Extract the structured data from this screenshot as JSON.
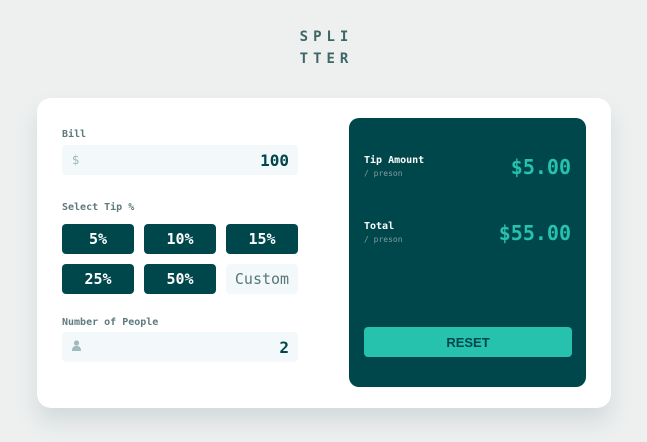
{
  "logo": {
    "line1": "SPLI",
    "line2": "TTER"
  },
  "bill": {
    "label": "Bill",
    "currency_symbol": "$",
    "value": "100"
  },
  "tip": {
    "label": "Select Tip %",
    "options": [
      "5%",
      "10%",
      "15%",
      "25%",
      "50%"
    ],
    "custom_placeholder": "Custom"
  },
  "people": {
    "label": "Number of People",
    "value": "2"
  },
  "results": {
    "tip_amount": {
      "title": "Tip Amount",
      "sub": "/ preson",
      "value": "$5.00"
    },
    "total": {
      "title": "Total",
      "sub": "/ preson",
      "value": "$55.00"
    }
  },
  "reset_label": "RESET",
  "colors": {
    "dark_cyan": "#00474b",
    "strong_cyan": "#26c2ae",
    "input_bg": "#f3f8fb",
    "label_gray": "#5e7a7d"
  },
  "icons": {
    "bill": "dollar-icon",
    "people": "person-icon"
  }
}
